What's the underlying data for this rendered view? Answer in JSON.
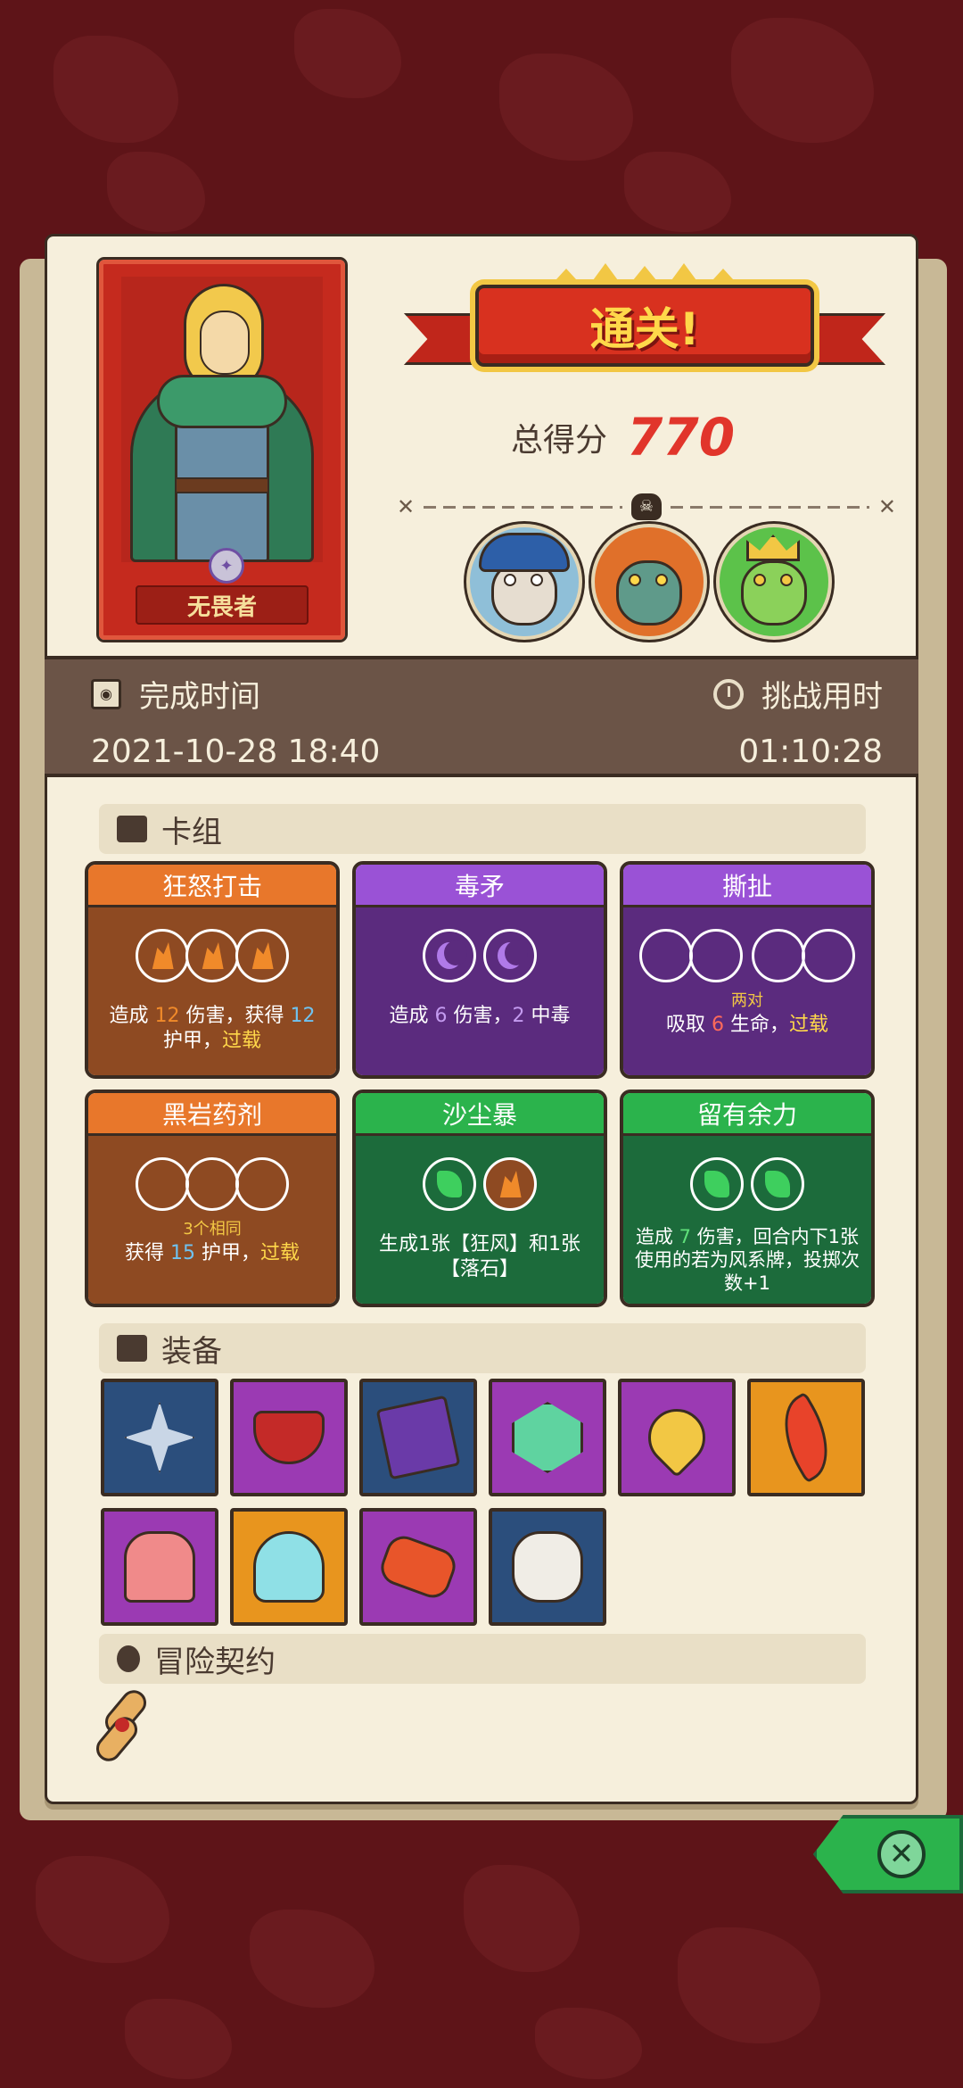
{
  "result": {
    "banner": "通关!",
    "score_label": "总得分",
    "score_value": "770"
  },
  "hero": {
    "name": "无畏者"
  },
  "time": {
    "finish_label": "完成时间",
    "finish_value": "2021-10-28 18:40",
    "challenge_label": "挑战用时",
    "challenge_value": "01:10:28"
  },
  "sections": {
    "deck": "卡组",
    "equipment": "装备",
    "contract": "冒险契约"
  },
  "cards": [
    {
      "title": "狂怒打击",
      "note": "",
      "desc_parts": [
        "造成 ",
        "12",
        " 伤害，获得 ",
        "12",
        " 护甲，",
        "过载"
      ]
    },
    {
      "title": "毒矛",
      "note": "",
      "desc_parts": [
        "造成 ",
        "6",
        " 伤害，",
        "2",
        " 中毒"
      ]
    },
    {
      "title": "撕扯",
      "note": "两对",
      "desc_parts": [
        "吸取 ",
        "6",
        " 生命，",
        "过载"
      ]
    },
    {
      "title": "黑岩药剂",
      "note": "3个相同",
      "desc_parts": [
        "获得 ",
        "15",
        " 护甲，",
        "过载"
      ]
    },
    {
      "title": "沙尘暴",
      "note": "",
      "desc": "生成1张【狂风】和1张【落石】"
    },
    {
      "title": "留有余力",
      "note": "",
      "desc_parts": [
        "造成 ",
        "7",
        " 伤害，回合内下1张使用的若为",
        "风系牌，投掷次数+1"
      ]
    }
  ],
  "equipment": [
    {
      "icon": "compass-star-icon",
      "color": "#2b4e7c"
    },
    {
      "icon": "red-bowl-icon",
      "color": "#9b3ab3"
    },
    {
      "icon": "skull-tome-icon",
      "color": "#2b4e7c"
    },
    {
      "icon": "green-gem-icon",
      "color": "#9b3ab3"
    },
    {
      "icon": "heart-amulet-icon",
      "color": "#9b3ab3"
    },
    {
      "icon": "flame-feather-icon",
      "color": "#e8951e"
    },
    {
      "icon": "melting-cake-icon",
      "color": "#9b3ab3"
    },
    {
      "icon": "ghost-blob-icon",
      "color": "#e8951e"
    },
    {
      "icon": "spiked-bracer-icon",
      "color": "#9b3ab3"
    },
    {
      "icon": "horned-skull-icon",
      "color": "#2b4e7c"
    }
  ],
  "contract_icon": "scroll-icon",
  "close_icon": "close-icon"
}
